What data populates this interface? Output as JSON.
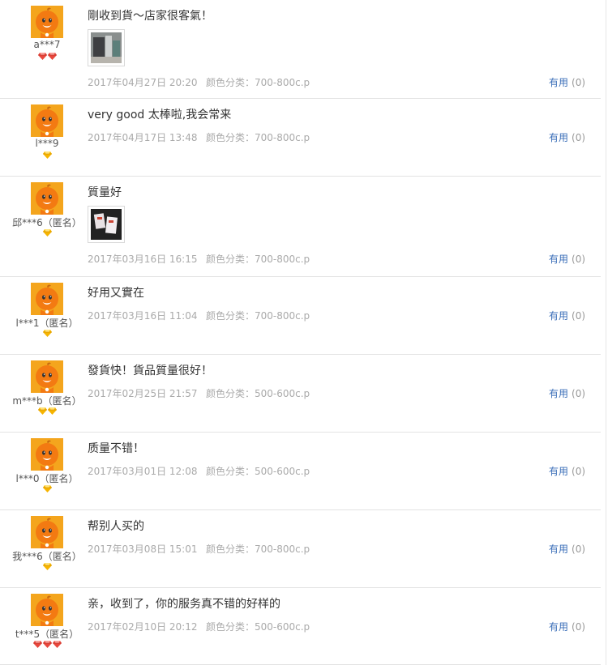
{
  "useful_label": "有用",
  "colors": {
    "link": "#3a6eb8",
    "muted": "#aaaaaa",
    "avatar": "#f4a51d",
    "badge_red": "#e8473c",
    "badge_yellow": "#f6b400"
  },
  "reviews": [
    {
      "user": "a***7",
      "badge_icon": "red-diamond-icon",
      "badge_count": 2,
      "comment": "剛收到貨～店家很客氣！",
      "photo_icon": "product-photo-icon",
      "date": "2017年04月27日 20:20",
      "spec": "颜色分类：700-800c.p",
      "useful_count": "(0)"
    },
    {
      "user": "l***9",
      "badge_icon": "yellow-heart-icon",
      "badge_count": 1,
      "comment": "very good 太棒啦,我会常来",
      "date": "2017年04月17日 13:48",
      "spec": "颜色分类：700-800c.p",
      "useful_count": "(0)"
    },
    {
      "user": "邱***6（匿名）",
      "badge_icon": "yellow-heart-icon",
      "badge_count": 1,
      "comment": "質量好",
      "photo_icon": "product-photo-icon",
      "date": "2017年03月16日 16:15",
      "spec": "颜色分类：700-800c.p",
      "useful_count": "(0)"
    },
    {
      "user": "l***1（匿名）",
      "badge_icon": "yellow-heart-icon",
      "badge_count": 1,
      "comment": "好用又實在",
      "date": "2017年03月16日 11:04",
      "spec": "颜色分类：700-800c.p",
      "useful_count": "(0)"
    },
    {
      "user": "m***b（匿名）",
      "badge_icon": "yellow-heart-icon",
      "badge_count": 2,
      "comment": "發貨快！貨品質量很好！",
      "date": "2017年02月25日 21:57",
      "spec": "颜色分类：500-600c.p",
      "useful_count": "(0)"
    },
    {
      "user": "l***0（匿名）",
      "badge_icon": "yellow-heart-icon",
      "badge_count": 1,
      "comment": "质量不错！",
      "date": "2017年03月01日 12:08",
      "spec": "颜色分类：500-600c.p",
      "useful_count": "(0)"
    },
    {
      "user": "我***6（匿名）",
      "badge_icon": "yellow-heart-icon",
      "badge_count": 1,
      "comment": "帮别人买的",
      "date": "2017年03月08日 15:01",
      "spec": "颜色分类：700-800c.p",
      "useful_count": "(0)"
    },
    {
      "user": "t***5（匿名）",
      "badge_icon": "red-diamond-icon",
      "badge_count": 3,
      "comment": "亲，收到了，你的服务真不错的好样的",
      "date": "2017年02月10日 20:12",
      "spec": "颜色分类：500-600c.p",
      "useful_count": "(0)"
    }
  ]
}
